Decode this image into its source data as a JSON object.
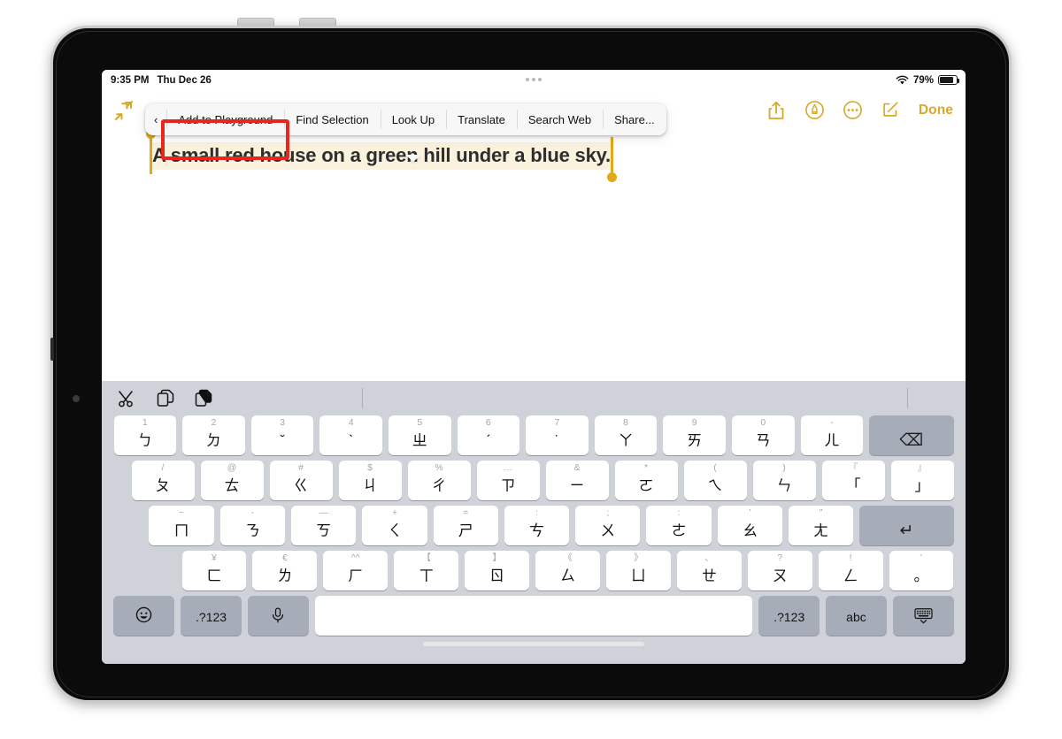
{
  "status_bar": {
    "time": "9:35 PM",
    "date": "Thu Dec 26",
    "wifi_icon": "wifi-icon",
    "battery_percent": "79%",
    "battery_icon": "battery-icon",
    "multitask_icon": "multitasking-dots-icon"
  },
  "toolbar": {
    "collapse_icon": "collapse-arrows-icon",
    "share_icon": "share-icon",
    "markup_icon": "markup-pen-icon",
    "more_icon": "more-ellipsis-icon",
    "compose_icon": "compose-icon",
    "done_label": "Done"
  },
  "edit_menu": {
    "back_chevron": "‹",
    "items": [
      {
        "label": "Add to Playground",
        "highlighted": true
      },
      {
        "label": "Find Selection",
        "highlighted": false
      },
      {
        "label": "Look Up",
        "highlighted": false
      },
      {
        "label": "Translate",
        "highlighted": false
      },
      {
        "label": "Search Web",
        "highlighted": false
      },
      {
        "label": "Share...",
        "highlighted": false
      }
    ],
    "highlight_color": "#e8261b"
  },
  "note": {
    "selected_text": "A small red house on a green hill under a blue sky.",
    "selection_color": "#faf2dd",
    "handle_color": "#e0a91c"
  },
  "keyboard": {
    "type": "zhuyin-bopomofo",
    "shortcut_bar": {
      "cut_icon": "cut-scissors-icon",
      "copy_icon": "copy-icon",
      "paste_icon": "paste-icon"
    },
    "rows": [
      [
        {
          "alt": "1",
          "main": "ㄅ"
        },
        {
          "alt": "2",
          "main": "ㄉ"
        },
        {
          "alt": "3",
          "main": "ˇ"
        },
        {
          "alt": "4",
          "main": "ˋ"
        },
        {
          "alt": "5",
          "main": "ㄓ"
        },
        {
          "alt": "6",
          "main": "ˊ"
        },
        {
          "alt": "7",
          "main": "˙"
        },
        {
          "alt": "8",
          "main": "ㄚ"
        },
        {
          "alt": "9",
          "main": "ㄞ"
        },
        {
          "alt": "0",
          "main": "ㄢ"
        },
        {
          "alt": "-",
          "main": "ㄦ"
        },
        {
          "alt": "",
          "main": "⌫",
          "name": "backspace-key",
          "gray": true
        }
      ],
      [
        {
          "alt": "/",
          "main": "ㄆ"
        },
        {
          "alt": "@",
          "main": "ㄊ"
        },
        {
          "alt": "#",
          "main": "ㄍ"
        },
        {
          "alt": "$",
          "main": "ㄐ"
        },
        {
          "alt": "%",
          "main": "ㄔ"
        },
        {
          "alt": "…",
          "main": "ㄗ"
        },
        {
          "alt": "&",
          "main": "ㄧ"
        },
        {
          "alt": "*",
          "main": "ㄛ"
        },
        {
          "alt": "(",
          "main": "ㄟ"
        },
        {
          "alt": ")",
          "main": "ㄣ"
        },
        {
          "alt": "『",
          "main": "「"
        },
        {
          "alt": "』",
          "main": "」"
        }
      ],
      [
        {
          "alt": "~",
          "main": "ㄇ"
        },
        {
          "alt": "-",
          "main": "ㄋ"
        },
        {
          "alt": "—",
          "main": "ㄎ"
        },
        {
          "alt": "+",
          "main": "ㄑ"
        },
        {
          "alt": "=",
          "main": "ㄕ"
        },
        {
          "alt": ":",
          "main": "ㄘ"
        },
        {
          "alt": ";",
          "main": "ㄨ"
        },
        {
          "alt": ":",
          "main": "ㄜ"
        },
        {
          "alt": "'",
          "main": "ㄠ"
        },
        {
          "alt": "\"",
          "main": "ㄤ"
        },
        {
          "alt": "",
          "main": "↵",
          "name": "return-key",
          "gray": true
        }
      ],
      [
        {
          "alt": "¥",
          "main": "ㄈ"
        },
        {
          "alt": "€",
          "main": "ㄌ"
        },
        {
          "alt": "^^",
          "main": "ㄏ"
        },
        {
          "alt": "【",
          "main": "ㄒ"
        },
        {
          "alt": "】",
          "main": "ㄖ"
        },
        {
          "alt": "《",
          "main": "ㄙ"
        },
        {
          "alt": "》",
          "main": "ㄩ"
        },
        {
          "alt": "、",
          "main": "ㄝ"
        },
        {
          "alt": "?",
          "main": "ㄡ"
        },
        {
          "alt": "!",
          "main": "ㄥ"
        },
        {
          "alt": "'",
          "main": "。"
        }
      ]
    ],
    "bottom_row": {
      "emoji_icon": "emoji-smiley-icon",
      "numeric_left_label": ".?123",
      "dictation_icon": "microphone-icon",
      "space_label": "",
      "numeric_right_label": ".?123",
      "abc_label": "abc",
      "dismiss_icon": "dismiss-keyboard-icon"
    }
  }
}
